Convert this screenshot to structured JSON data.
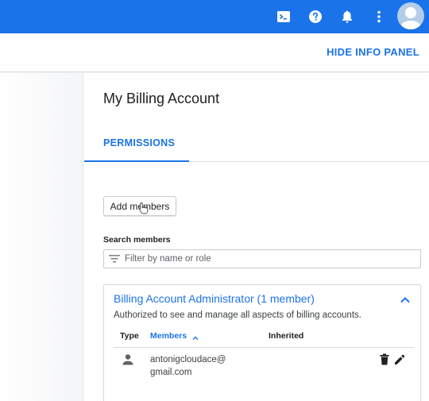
{
  "topbar": {
    "icons": [
      "cloud-shell-icon",
      "help-icon",
      "notifications-icon",
      "more-vert-icon",
      "avatar"
    ],
    "color": "#1a73e8"
  },
  "subbar": {
    "hide_info_label": "HIDE INFO PANEL"
  },
  "panel": {
    "title": "My Billing Account",
    "tabs": [
      {
        "label": "PERMISSIONS",
        "active": true
      }
    ],
    "add_members_label": "Add members",
    "search_label": "Search members",
    "filter_placeholder": "Filter by name or role"
  },
  "role": {
    "title": "Billing Account Administrator (1 member)",
    "description": "Authorized to see and manage all aspects of billing accounts.",
    "expanded": true,
    "columns": {
      "type": "Type",
      "members": "Members",
      "inherited": "Inherited"
    },
    "members": [
      {
        "type_icon": "person-icon",
        "email_line1": "antonigcloudace@",
        "email_line2": "gmail.com",
        "inherited": ""
      }
    ]
  },
  "accent": "#1a73e8"
}
